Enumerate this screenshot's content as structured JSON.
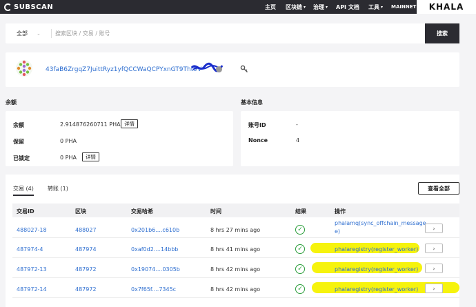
{
  "header": {
    "logo_text": "SUBSCAN",
    "nav": [
      {
        "label": "主页",
        "caret": ""
      },
      {
        "label": "区块链",
        "caret": "▾"
      },
      {
        "label": "治理",
        "caret": "▾"
      },
      {
        "label": "API 文档",
        "caret": ""
      },
      {
        "label": "工具",
        "caret": "▾"
      },
      {
        "label": "MAINNET",
        "caret": ""
      }
    ],
    "network_name": "KHALA"
  },
  "search": {
    "filter_value": "全部",
    "placeholder": "搜索区块 / 交易 / 账号",
    "button_label": "搜索"
  },
  "account": {
    "address": "43faB6ZrgqZ7JuittRyz1yfQCCWaQCPYxnGT9Tht9V"
  },
  "balance": {
    "title": "余额",
    "rows": [
      {
        "label": "余额",
        "value": "2.914876260711 PHA",
        "button": "详情"
      },
      {
        "label": "保留",
        "value": "0 PHA",
        "button": ""
      },
      {
        "label": "已锁定",
        "value": "0 PHA",
        "button": "详情"
      }
    ]
  },
  "basic_info": {
    "title": "基本信息",
    "rows": [
      {
        "label": "账号ID",
        "value": "-"
      },
      {
        "label": "Nonce",
        "value": "4"
      }
    ]
  },
  "transactions": {
    "tabs": [
      {
        "label": "交易 (4)"
      },
      {
        "label": "转账 (1)"
      }
    ],
    "view_all": "查看全部",
    "columns": [
      "交易ID",
      "区块",
      "交易哈希",
      "时间",
      "结果",
      "操作"
    ],
    "rows": [
      {
        "id": "488027-18",
        "block": "488027",
        "hash": "0x201b6....c610b",
        "time": "8 hrs 27 mins ago",
        "action_line1": "phalamq(sync_offchain_message",
        "action_line2": "e)"
      },
      {
        "id": "487974-4",
        "block": "487974",
        "hash": "0xaf0d2....14bbb",
        "time": "8 hrs 41 mins ago",
        "action_line1": "phalaregistry(register_worker)",
        "action_line2": ""
      },
      {
        "id": "487972-13",
        "block": "487972",
        "hash": "0x19074....0305b",
        "time": "8 hrs 42 mins ago",
        "action_line1": "phalaregistry(register_worker)",
        "action_line2": ""
      },
      {
        "id": "487972-14",
        "block": "487972",
        "hash": "0x7f65f....7345c",
        "time": "8 hrs 42 mins ago",
        "action_line1": "phalaregistry(register_worker)",
        "action_line2": ""
      }
    ]
  },
  "colors": {
    "header_bg": "#2b2b31",
    "link": "#2f6fd0",
    "success": "#2a9d3a",
    "highlight": "#f6f200"
  }
}
